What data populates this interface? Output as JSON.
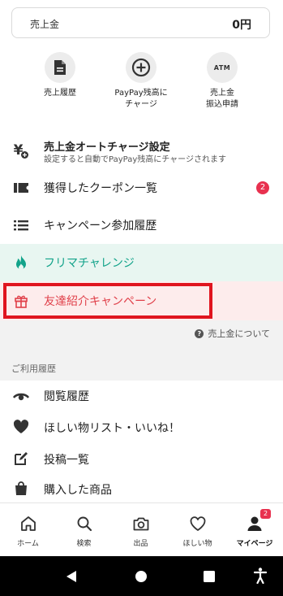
{
  "sales": {
    "label": "売上金",
    "value": "0円"
  },
  "quick_actions": [
    {
      "label": "売上履歴",
      "icon": "document-icon"
    },
    {
      "label": "PayPay残高に\nチャージ",
      "icon": "plus-circle-icon"
    },
    {
      "label": "売上金\n振込申請",
      "icon": "atm-icon",
      "icon_text": "ATM"
    }
  ],
  "menu": {
    "auto_charge": {
      "title": "売上金オートチャージ設定",
      "subtitle": "設定すると自動でPayPay残高にチャージされます"
    },
    "coupons": {
      "label": "獲得したクーポン一覧",
      "badge": "2"
    },
    "campaign_history": {
      "label": "キャンペーン参加履歴"
    },
    "flea_challenge": {
      "label": "フリマチャレンジ"
    },
    "referral": {
      "label": "友達紹介キャンペーン"
    }
  },
  "help_link": {
    "label": "売上金について",
    "icon_text": "?"
  },
  "history_section": {
    "header": "ご利用履歴",
    "items": [
      {
        "label": "閲覧履歴",
        "icon": "eye-icon"
      },
      {
        "label": "ほしい物リスト・いいね！",
        "icon": "heart-icon"
      },
      {
        "label": "投稿一覧",
        "icon": "edit-icon"
      },
      {
        "label": "購入した商品",
        "icon": "shopping-bag-icon"
      }
    ]
  },
  "bottom_nav": {
    "items": [
      {
        "label": "ホーム",
        "icon": "home-icon"
      },
      {
        "label": "検索",
        "icon": "search-icon"
      },
      {
        "label": "出品",
        "icon": "camera-icon"
      },
      {
        "label": "ほしい物",
        "icon": "heart-icon"
      },
      {
        "label": "マイページ",
        "icon": "user-icon",
        "badge": "2",
        "active": true
      }
    ]
  },
  "colors": {
    "accent_red": "#e8314f",
    "highlight_border": "#e0141e",
    "flea_green": "#12a38a",
    "flea_bg": "#e8f6f1",
    "referral_bg": "#fdecec",
    "referral_text": "#e0404a"
  }
}
